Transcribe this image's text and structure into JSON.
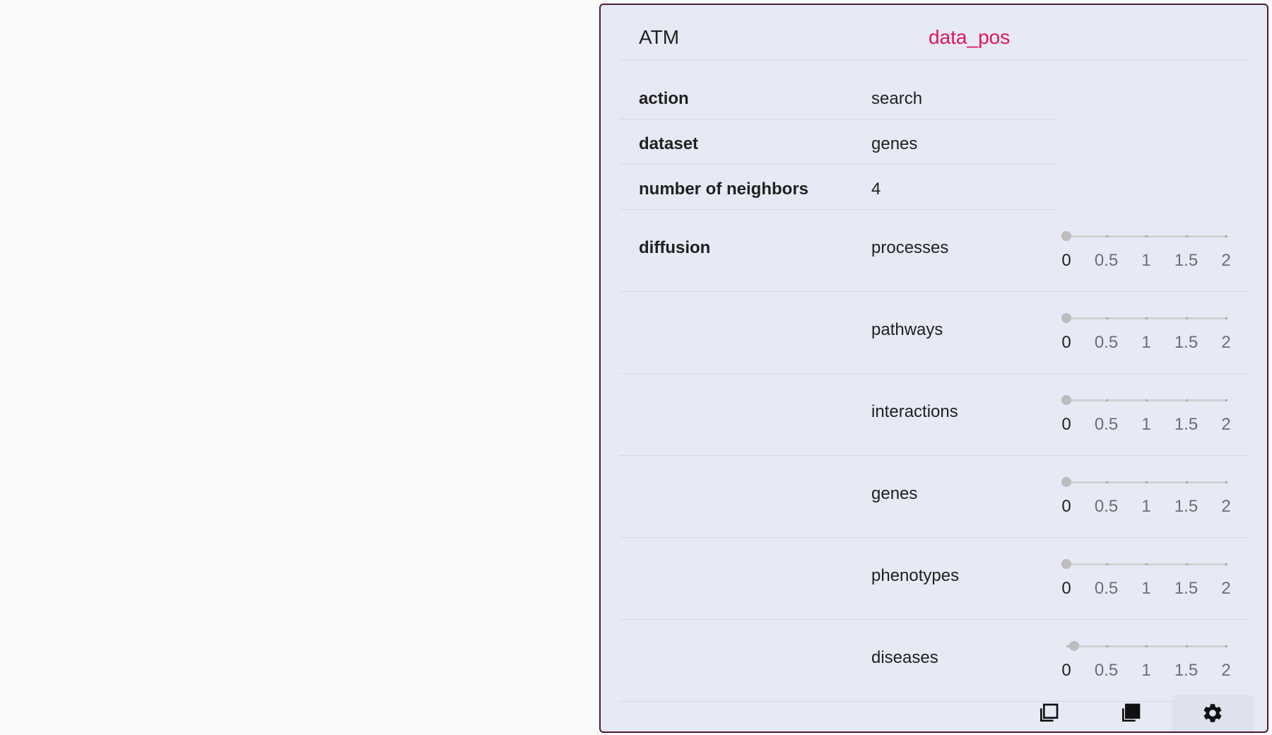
{
  "header": {
    "gene": "ATM",
    "tag": "data_pos"
  },
  "fields": [
    {
      "key": "action",
      "value": "search"
    },
    {
      "key": "dataset",
      "value": "genes"
    },
    {
      "key": "number of neighbors",
      "value": "4"
    }
  ],
  "diffusion": {
    "label": "diffusion",
    "scale": {
      "min": 0,
      "max": 2,
      "ticks": [
        "0",
        "0.5",
        "1",
        "1.5",
        "2"
      ]
    },
    "rows": [
      {
        "name": "processes",
        "value": 0
      },
      {
        "name": "pathways",
        "value": 0
      },
      {
        "name": "interactions",
        "value": 0
      },
      {
        "name": "genes",
        "value": 0
      },
      {
        "name": "phenotypes",
        "value": 0
      },
      {
        "name": "diseases",
        "value": 0.1
      }
    ]
  },
  "footer": {
    "buttons": [
      {
        "icon": "copy-outline-icon",
        "active": false
      },
      {
        "icon": "copy-filled-icon",
        "active": false
      },
      {
        "icon": "gear-icon",
        "active": true
      }
    ]
  },
  "colors": {
    "accent": "#e0155e",
    "border": "#4a1a3a",
    "card_bg": "#e7eaf5"
  }
}
